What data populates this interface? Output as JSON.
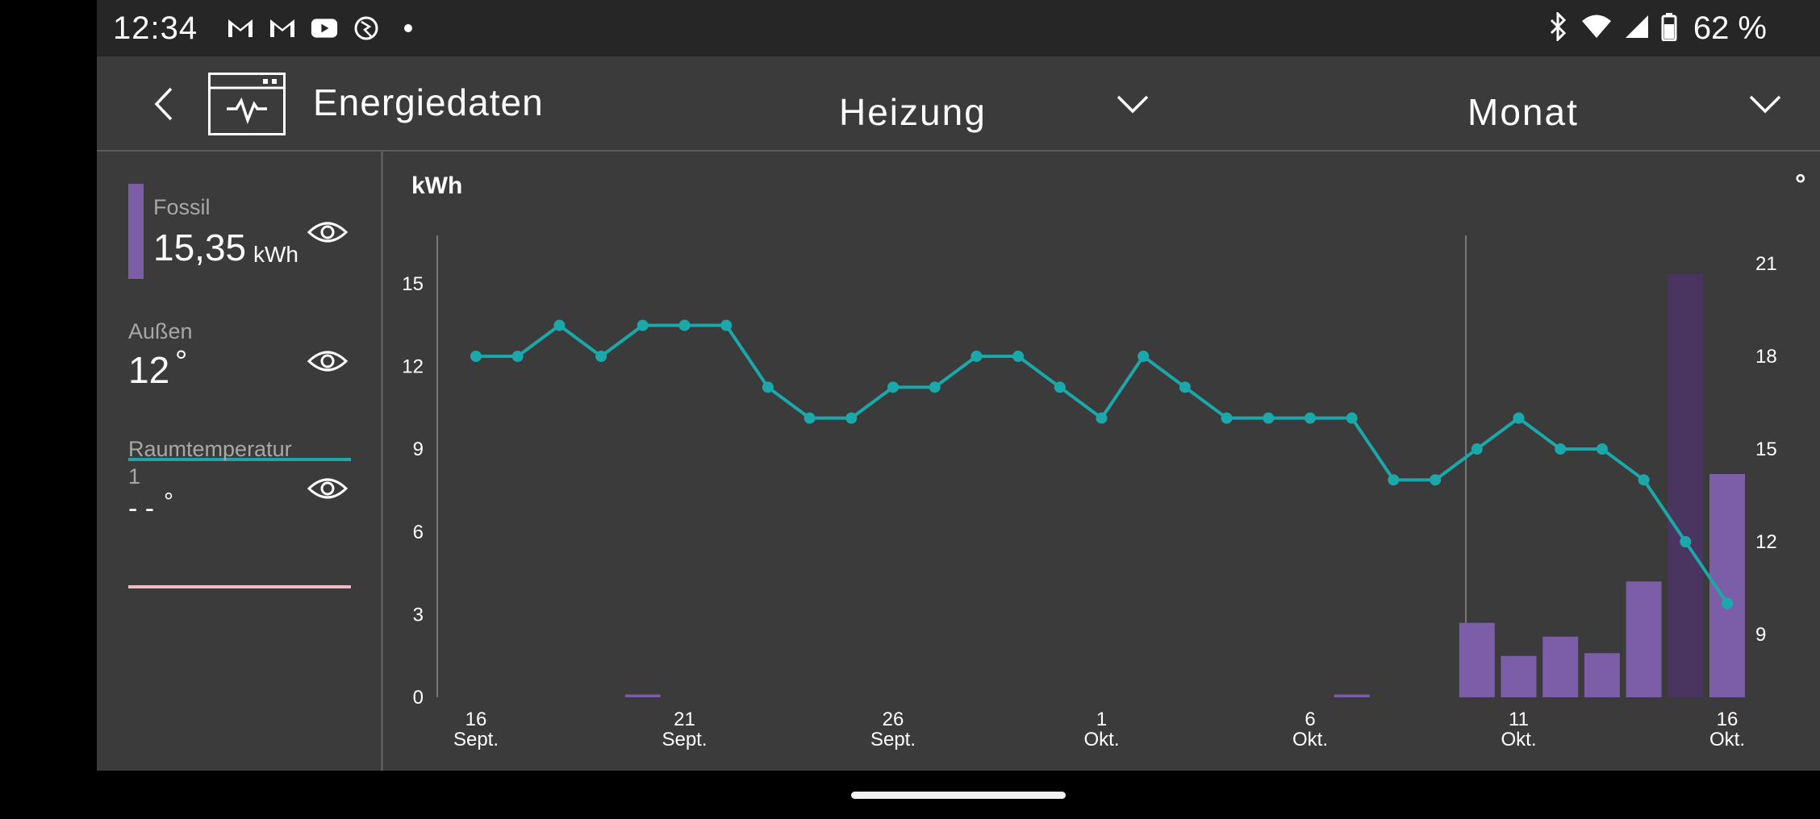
{
  "status_bar": {
    "time": "12:34",
    "battery_percent": "62 %",
    "left_icons": [
      "gmail-icon",
      "gmail-icon",
      "youtube-icon",
      "web-icon",
      "dot-icon"
    ],
    "right_icons": [
      "bluetooth-icon",
      "wifi-icon",
      "signal-icon",
      "battery-icon"
    ]
  },
  "header": {
    "title": "Energiedaten",
    "category_select": "Heizung",
    "period_select": "Monat"
  },
  "legend": {
    "fossil": {
      "name": "Fossil",
      "value": "15,35",
      "unit": "kWh",
      "color": "#7b5ea7"
    },
    "outside": {
      "name": "Außen",
      "value": "12",
      "unit": "°",
      "color": "#1ba8aa"
    },
    "room": {
      "name": "Raumtemperatur 1",
      "value": "- -",
      "unit": "°",
      "color": "#f2b8c6"
    }
  },
  "chart_data": {
    "type": "bar+line",
    "ylabel_left": "kWh",
    "ylabel_right": "°",
    "ylim_left": [
      0,
      16.8
    ],
    "ylim_right": [
      6.3,
      22.2
    ],
    "yticks_left": [
      0,
      3,
      6,
      9,
      12,
      15
    ],
    "yticks_right": [
      9,
      12,
      15,
      18,
      21
    ],
    "x_tick_labels": [
      {
        "day": "16",
        "month": "Sept.",
        "index": 0
      },
      {
        "day": "21",
        "month": "Sept.",
        "index": 5
      },
      {
        "day": "26",
        "month": "Sept.",
        "index": 10
      },
      {
        "day": "1",
        "month": "Okt.",
        "index": 15
      },
      {
        "day": "6",
        "month": "Okt.",
        "index": 20
      },
      {
        "day": "11",
        "month": "Okt.",
        "index": 25
      },
      {
        "day": "16",
        "month": "Okt.",
        "index": 30
      }
    ],
    "dates": [
      "16.09",
      "17.09",
      "18.09",
      "19.09",
      "20.09",
      "21.09",
      "22.09",
      "23.09",
      "24.09",
      "25.09",
      "26.09",
      "27.09",
      "28.09",
      "29.09",
      "30.09",
      "01.10",
      "02.10",
      "03.10",
      "04.10",
      "05.10",
      "06.10",
      "07.10",
      "08.10",
      "09.10",
      "10.10",
      "11.10",
      "12.10",
      "13.10",
      "14.10",
      "15.10",
      "16.10"
    ],
    "series": [
      {
        "name": "Fossil",
        "axis": "left",
        "kind": "bar",
        "color": "#7b5ea7",
        "values": [
          0,
          0,
          0,
          0,
          0.1,
          0,
          0,
          0,
          0,
          0,
          0,
          0,
          0,
          0,
          0,
          0,
          0,
          0,
          0,
          0,
          0,
          0.1,
          0,
          0,
          2.7,
          1.5,
          2.2,
          1.6,
          4.2,
          15.35,
          8.1
        ],
        "highlighted_index": 29,
        "highlight_color": "#4a3560"
      },
      {
        "name": "Außen",
        "axis": "right",
        "kind": "line",
        "color": "#1ba8aa",
        "values": [
          18,
          18,
          19,
          18,
          19,
          19,
          19,
          17,
          16,
          16,
          17,
          17,
          18,
          18,
          17,
          16,
          18,
          17,
          16,
          16,
          16,
          16,
          14,
          14,
          15,
          16,
          15,
          15,
          14,
          12,
          10
        ]
      }
    ],
    "legend_position": "left-panel",
    "grid": false
  }
}
